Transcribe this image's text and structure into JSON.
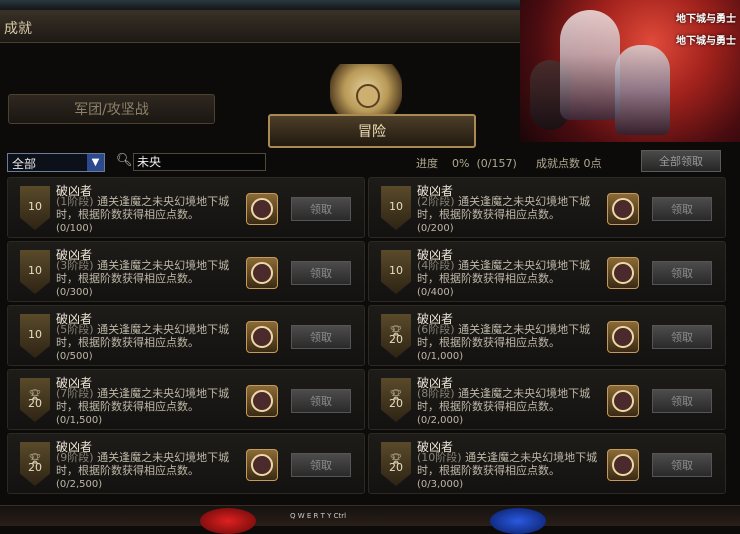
{
  "window": {
    "title": "成就"
  },
  "tabs": {
    "left": "军团/攻坚战",
    "active": "冒险"
  },
  "toolbar": {
    "filter_value": "全部",
    "search_value": "未央",
    "progress_label": "进度",
    "progress_value": "0%",
    "progress_count": "(0/157)",
    "points_label": "成就点数",
    "points_value": "0点",
    "claim_all": "全部领取"
  },
  "banner": {
    "logo_text": "地下城与勇士"
  },
  "bottom": {
    "keys": "Q W E R T Y Ctrl"
  },
  "achievements": [
    {
      "name": "破凶者",
      "stage": "(1阶段)",
      "desc": "通关逢魔之未央幻境地下城时，根据阶数获得相应点数。",
      "count": "(0/100)",
      "badge": "10",
      "trophy": false,
      "claim": "领取"
    },
    {
      "name": "破凶者",
      "stage": "(2阶段)",
      "desc": "通关逢魔之未央幻境地下城时，根据阶数获得相应点数。",
      "count": "(0/200)",
      "badge": "10",
      "trophy": false,
      "claim": "领取"
    },
    {
      "name": "破凶者",
      "stage": "(3阶段)",
      "desc": "通关逢魔之未央幻境地下城时，根据阶数获得相应点数。",
      "count": "(0/300)",
      "badge": "10",
      "trophy": false,
      "claim": "领取"
    },
    {
      "name": "破凶者",
      "stage": "(4阶段)",
      "desc": "通关逢魔之未央幻境地下城时，根据阶数获得相应点数。",
      "count": "(0/400)",
      "badge": "10",
      "trophy": false,
      "claim": "领取"
    },
    {
      "name": "破凶者",
      "stage": "(5阶段)",
      "desc": "通关逢魔之未央幻境地下城时，根据阶数获得相应点数。",
      "count": "(0/500)",
      "badge": "10",
      "trophy": false,
      "claim": "领取"
    },
    {
      "name": "破凶者",
      "stage": "(6阶段)",
      "desc": "通关逢魔之未央幻境地下城时，根据阶数获得相应点数。",
      "count": "(0/1,000)",
      "badge": "20",
      "trophy": true,
      "claim": "领取"
    },
    {
      "name": "破凶者",
      "stage": "(7阶段)",
      "desc": "通关逢魔之未央幻境地下城时，根据阶数获得相应点数。",
      "count": "(0/1,500)",
      "badge": "20",
      "trophy": true,
      "claim": "领取"
    },
    {
      "name": "破凶者",
      "stage": "(8阶段)",
      "desc": "通关逢魔之未央幻境地下城时，根据阶数获得相应点数。",
      "count": "(0/2,000)",
      "badge": "20",
      "trophy": true,
      "claim": "领取"
    },
    {
      "name": "破凶者",
      "stage": "(9阶段)",
      "desc": "通关逢魔之未央幻境地下城时，根据阶数获得相应点数。",
      "count": "(0/2,500)",
      "badge": "20",
      "trophy": true,
      "claim": "领取"
    },
    {
      "name": "破凶者",
      "stage": "(10阶段)",
      "desc": "通关逢魔之未央幻境地下城时，根据阶数获得相应点数。",
      "count": "(0/3,000)",
      "badge": "20",
      "trophy": true,
      "claim": "领取"
    }
  ]
}
